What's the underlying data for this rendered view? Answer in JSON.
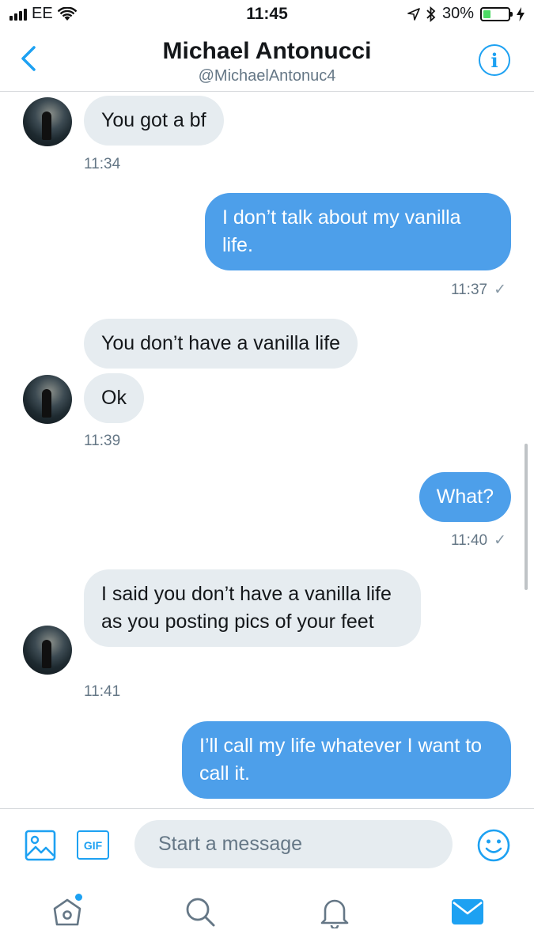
{
  "status_bar": {
    "carrier": "EE",
    "time": "11:45",
    "battery": "30%",
    "battery_level": 0.3
  },
  "header": {
    "name": "Michael Antonucci",
    "handle": "@MichaelAntonuc4"
  },
  "messages": [
    {
      "text": "You got a bf"
    },
    {
      "text": "I don’t talk about my vanilla life."
    },
    {
      "text": "You don’t have a vanilla life"
    },
    {
      "text": "Ok"
    },
    {
      "text": "What?"
    },
    {
      "text": "I said you don’t have a vanilla life as you posting pics of your feet"
    },
    {
      "text": "I’ll call my life whatever I want to call it."
    }
  ],
  "timestamps": [
    {
      "text": "11:34",
      "read_mark": ""
    },
    {
      "text": "11:37",
      "read_mark": "✓"
    },
    {
      "text": "11:39",
      "read_mark": ""
    },
    {
      "text": "11:40",
      "read_mark": "✓"
    },
    {
      "text": "11:41",
      "read_mark": ""
    }
  ],
  "composer": {
    "placeholder": "Start a message",
    "gif_label": "GIF"
  },
  "colors": {
    "accent": "#1da1f2",
    "outgoing_bubble": "#4d9fea",
    "incoming_bubble": "#e6ecf0",
    "muted_text": "#657786"
  },
  "icons": {
    "back": "chevron-left-icon",
    "info": "info-icon",
    "image": "image-icon",
    "gif": "gif-icon",
    "emoji": "emoji-icon",
    "home": "home-icon",
    "search": "search-icon",
    "notifications": "bell-icon",
    "messages": "mail-icon"
  }
}
